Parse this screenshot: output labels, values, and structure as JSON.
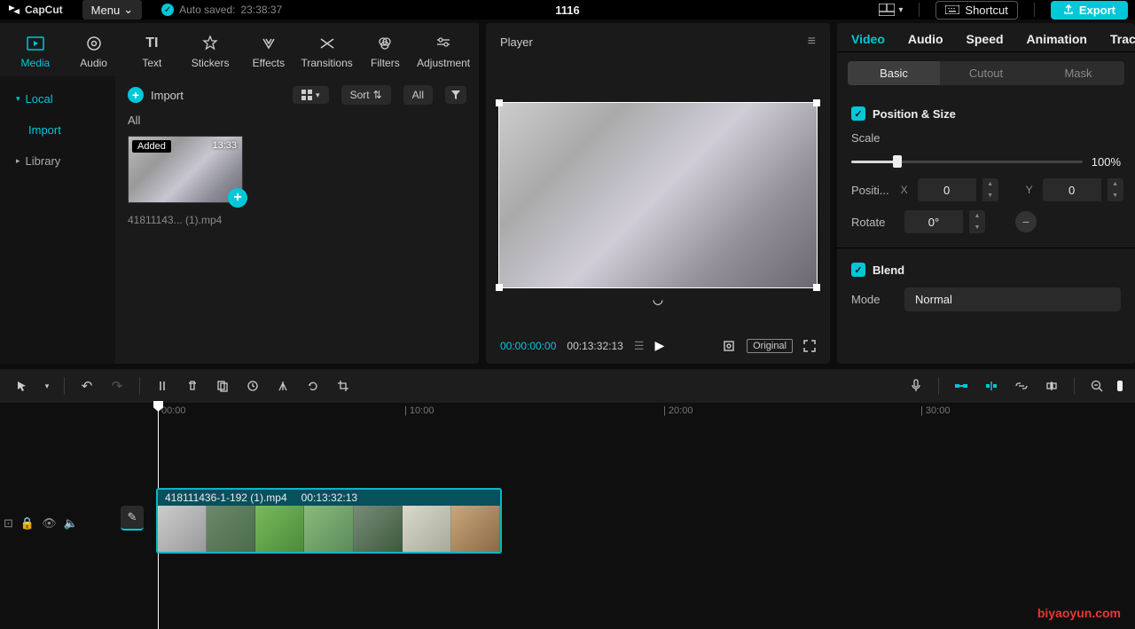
{
  "menubar": {
    "app_name": "CapCut",
    "menu_label": "Menu",
    "autosave_prefix": "Auto saved:",
    "autosave_time": "23:38:37",
    "project_title": "1116",
    "shortcut_label": "Shortcut",
    "export_label": "Export"
  },
  "tool_tabs": {
    "media": "Media",
    "audio": "Audio",
    "text": "Text",
    "stickers": "Stickers",
    "effects": "Effects",
    "transitions": "Transitions",
    "filters": "Filters",
    "adjustment": "Adjustment"
  },
  "side": {
    "local": "Local",
    "import": "Import",
    "library": "Library"
  },
  "media": {
    "import_btn": "Import",
    "sort_label": "Sort",
    "all_label": "All",
    "filter_all": "All",
    "thumb_badge": "Added",
    "thumb_duration": "13:33",
    "thumb_name": "41811143... (1).mp4"
  },
  "player": {
    "title": "Player",
    "current_time": "00:00:00:00",
    "total_time": "00:13:32:13",
    "original_label": "Original"
  },
  "props": {
    "tabs": {
      "video": "Video",
      "audio": "Audio",
      "speed": "Speed",
      "animation": "Animation",
      "track": "Track"
    },
    "subtabs": {
      "basic": "Basic",
      "cutout": "Cutout",
      "mask": "Mask"
    },
    "position_size": "Position & Size",
    "scale_label": "Scale",
    "scale_value": "100%",
    "position_label": "Positi...",
    "x_label": "X",
    "x_value": "0",
    "y_label": "Y",
    "y_value": "0",
    "rotate_label": "Rotate",
    "rotate_value": "0°",
    "blend_label": "Blend",
    "mode_label": "Mode",
    "mode_value": "Normal"
  },
  "timeline": {
    "marks": [
      "00:00",
      "| 10:00",
      "| 20:00",
      "| 30:00"
    ],
    "clip_name": "418111436-1-192 (1).mp4",
    "clip_duration": "00:13:32:13"
  },
  "watermark": "biyaoyun.com"
}
